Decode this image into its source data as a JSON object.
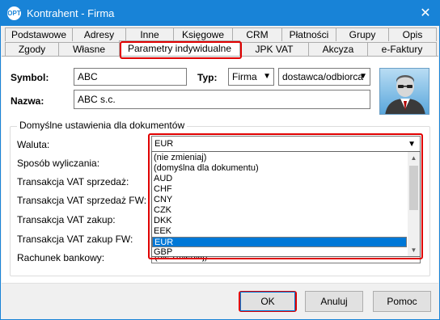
{
  "window": {
    "title": "Kontrahent - Firma",
    "app_icon_text": "OPT",
    "close_glyph": "✕"
  },
  "tabs_row1": [
    "Podstawowe",
    "Adresy",
    "Inne",
    "Księgowe",
    "CRM",
    "Płatności",
    "Grupy",
    "Opis"
  ],
  "tabs_row2": [
    "Zgody",
    "Własne",
    "Parametry indywidualne",
    "JPK VAT",
    "Akcyza",
    "e-Faktury"
  ],
  "active_tab": "Parametry indywidualne",
  "header": {
    "symbol_label": "Symbol:",
    "symbol_value": "ABC",
    "typ_label": "Typ:",
    "typ_value": "Firma",
    "role_value": "dostawca/odbiorca",
    "nazwa_label": "Nazwa:",
    "nazwa_value": "ABC s.c."
  },
  "defaults_group": {
    "title": "Domyślne ustawienia dla dokumentów",
    "fields": {
      "waluta": "Waluta:",
      "sposob": "Sposób wyliczania:",
      "vat_sprzedaz": "Transakcja VAT sprzedaż:",
      "vat_sprzedaz_fw": "Transakcja VAT sprzedaż FW:",
      "vat_zakup": "Transakcja VAT zakup:",
      "vat_zakup_fw": "Transakcja VAT zakup FW:",
      "rachunek": "Rachunek bankowy:"
    },
    "waluta_value": "EUR",
    "rachunek_value": "(nie zmieniaj)",
    "waluta_options": [
      "(nie zmieniaj)",
      "(domyślna dla dokumentu)",
      "AUD",
      "CHF",
      "CNY",
      "CZK",
      "DKK",
      "EEK",
      "EUR",
      "GBP"
    ],
    "waluta_selected": "EUR"
  },
  "buttons": {
    "ok": "OK",
    "cancel": "Anuluj",
    "help": "Pomoc"
  },
  "colors": {
    "titlebar": "#1883d7",
    "selection": "#0078d7",
    "highlight": "#e00000"
  }
}
